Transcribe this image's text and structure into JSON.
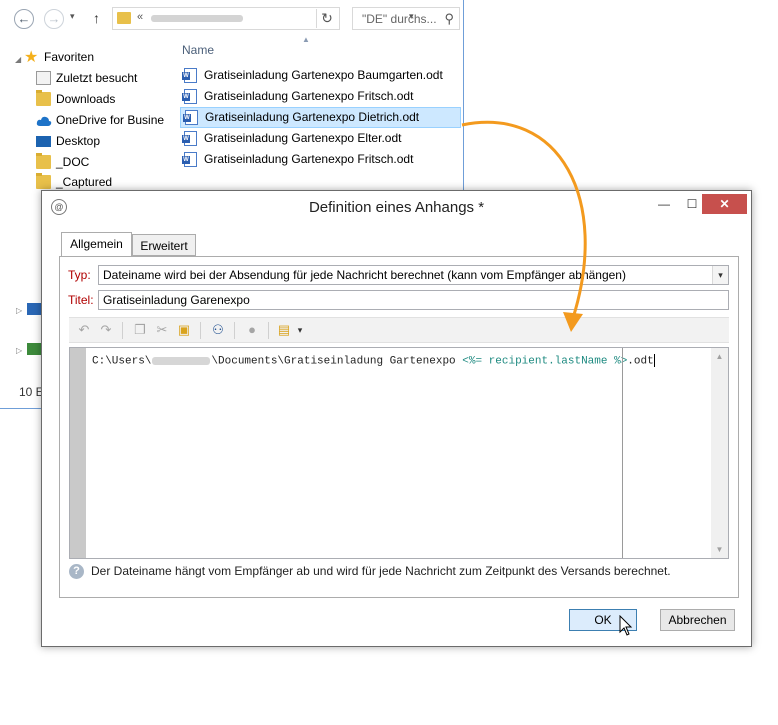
{
  "explorer": {
    "search_placeholder": "\"DE\" durchs...",
    "column_header": "Name",
    "nav": {
      "favorites_label": "Favoriten",
      "items": [
        "Zuletzt besucht",
        "Downloads",
        "OneDrive for Busine",
        "Desktop",
        "_DOC",
        "_Captured"
      ]
    },
    "files": [
      "Gratiseinladung Gartenexpo Baumgarten.odt",
      "Gratiseinladung Gartenexpo Fritsch.odt",
      "Gratiseinladung Gartenexpo Dietrich.odt",
      "Gratiseinladung Gartenexpo Elter.odt",
      "Gratiseinladung Gartenexpo Fritsch.odt"
    ],
    "item_count": "10 E",
    "address_prefix": "«"
  },
  "dialog": {
    "title": "Definition eines Anhangs *",
    "tabs": [
      "Allgemein",
      "Erweitert"
    ],
    "typ_label": "Typ:",
    "typ_value": "Dateiname wird bei der Absendung für jede Nachricht berechnet (kann vom Empfänger abhängen)",
    "titel_label": "Titel:",
    "titel_value": "Gratiseinladung Garenexpo",
    "code_prefix": "C:\\Users\\",
    "code_middle": "\\Documents\\Gratiseinladung Gartenexpo ",
    "code_template": "<%= recipient.lastName %>",
    "code_suffix": ".odt",
    "hint": "Der Dateiname hängt vom Empfänger ab und wird für jede Nachricht zum Zeitpunkt des Versands berechnet.",
    "ok_label": "OK",
    "cancel_label": "Abbrechen"
  },
  "colors": {
    "arrow": "#f39a1e",
    "close_button": "#c7504d",
    "selection": "#cde8ff",
    "template_code": "#1d8a80",
    "label_red": "#b00000"
  }
}
